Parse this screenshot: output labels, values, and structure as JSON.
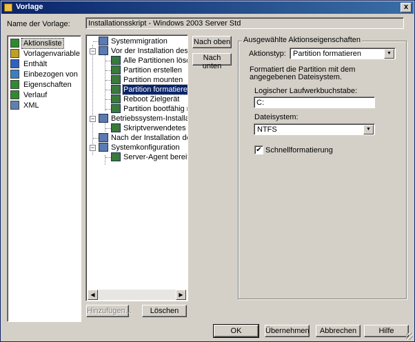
{
  "window": {
    "title": "Vorlage",
    "close_glyph": "x"
  },
  "template_name": {
    "label": "Name der Vorlage:",
    "value": "Installationsskript - Windows 2003 Server Std"
  },
  "nav": {
    "items": [
      {
        "label": "Aktionsliste",
        "icon": "action-list-icon",
        "color": "#2e8b2e"
      },
      {
        "label": "Vorlagenvariable",
        "icon": "variable-icon",
        "color": "#c0a020"
      },
      {
        "label": "Enthält",
        "icon": "users-icon",
        "color": "#3060c0"
      },
      {
        "label": "Einbezogen von",
        "icon": "monitor-icon",
        "color": "#3a80c0"
      },
      {
        "label": "Eigenschaften",
        "icon": "properties-icon",
        "color": "#2e8b2e"
      },
      {
        "label": "Verlauf",
        "icon": "history-icon",
        "color": "#2e8b2e"
      },
      {
        "label": "XML",
        "icon": "xml-icon",
        "color": "#6080b0"
      }
    ]
  },
  "tree": {
    "nodes": [
      {
        "label": "Systemmigration",
        "icon": "migration-icon"
      },
      {
        "label": "Vor der Installation des Betrie",
        "icon": "phase-icon"
      },
      {
        "label": "Alle Partitionen löschen",
        "icon": "action-icon"
      },
      {
        "label": "Partition erstellen",
        "icon": "action-icon"
      },
      {
        "label": "Partition mounten",
        "icon": "action-icon"
      },
      {
        "label": "Partition formatieren",
        "icon": "action-icon"
      },
      {
        "label": "Reboot Zielgerät",
        "icon": "action-icon"
      },
      {
        "label": "Partition bootfähig mach",
        "icon": "action-icon"
      },
      {
        "label": "Betriebssystem-Installationen",
        "icon": "phase-icon"
      },
      {
        "label": "Skriptverwendetes Insta",
        "icon": "action-icon"
      },
      {
        "label": "Nach der Installation des Be",
        "icon": "phase-icon"
      },
      {
        "label": "Systemkonfiguration",
        "icon": "phase-icon"
      },
      {
        "label": "Server-Agent bereitstelle",
        "icon": "action-icon"
      }
    ],
    "plus_minus": "−"
  },
  "buttons": {
    "move_up": "Nach oben",
    "move_down": "Nach unten",
    "add": "Hinzufügen...",
    "delete": "Löschen",
    "ok": "OK",
    "apply": "Übernehmen",
    "cancel": "Abbrechen",
    "help": "Hilfe"
  },
  "props": {
    "group_title": "Ausgewählte Aktionseigenschaften",
    "action_type_label": "Aktionstyp:",
    "action_type_value": "Partition formatieren",
    "description": "Formatiert die Partition mit dem angegebenen Dateisystem.",
    "drive_label": "Logischer Laufwerkbuchstabe:",
    "drive_value": "C:",
    "fs_label": "Dateisystem:",
    "fs_value": "NTFS",
    "quick_format_label": "Schnellformatierung",
    "quick_format_checked": true,
    "check_glyph": "✔"
  },
  "glyphs": {
    "combo_arrow": "▼",
    "scroll_left": "◀",
    "scroll_right": "▶"
  }
}
